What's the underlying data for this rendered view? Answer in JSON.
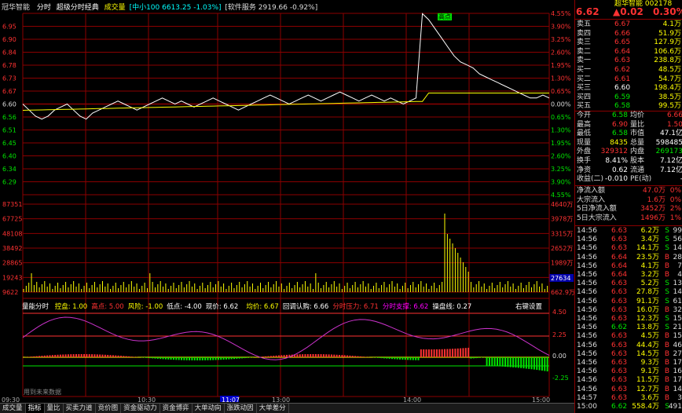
{
  "header": {
    "title": "冠华智能",
    "mode1": "分时",
    "mode2": "超级分时经典",
    "indicator": "成交量",
    "index_info": "[中小100 6613.25 -1.03%]",
    "sector_info": "[软件服务 2919.66 -0.92%]"
  },
  "price_axis_left": [
    "6.95",
    "6.90",
    "6.84",
    "6.78",
    "6.73",
    "6.67",
    "6.60",
    "6.56",
    "6.51",
    "6.45",
    "6.40",
    "6.34",
    "6.29"
  ],
  "pct_axis_right": [
    "4.55%",
    "3.90%",
    "3.25%",
    "2.60%",
    "1.95%",
    "1.30%",
    "0.65%",
    "0.00%",
    "0.65%",
    "1.30%",
    "1.95%",
    "2.60%",
    "3.25%",
    "3.90%",
    "4.55%"
  ],
  "vol_axis_left": [
    "87351",
    "67725",
    "48108",
    "38492",
    "28865",
    "19243",
    "9622"
  ],
  "vol_axis_right": [
    "4640万",
    "3978万",
    "3315万",
    "2652万",
    "1989万",
    "1326万",
    "662.9万"
  ],
  "vol_marker": "27634",
  "high_flag": "高点",
  "lower_panel": {
    "name": "量能分时",
    "items": [
      {
        "label": "控盘",
        "value": "1.00",
        "color": "#ffff00"
      },
      {
        "label": "高点",
        "value": "5.00",
        "color": "#ff3232"
      },
      {
        "label": "风险",
        "value": "-1.00",
        "color": "#ffff00"
      },
      {
        "label": "低点",
        "value": "-4.00",
        "color": "#ffffff"
      },
      {
        "label": "现价",
        "value": "6.62",
        "color": "#ffffff"
      },
      {
        "label": "",
        "value": "",
        "color": "#0000ff"
      },
      {
        "label": "均价",
        "value": "6.67",
        "color": "#ffff00"
      },
      {
        "label": "回调认购",
        "value": "6.66",
        "color": "#ffffff"
      },
      {
        "label": "分时压力",
        "value": "6.71",
        "color": "#ff3232"
      },
      {
        "label": "分时支撑",
        "value": "6.62",
        "color": "#ff00ff"
      },
      {
        "label": "操盘线",
        "value": "0.27",
        "color": "#ffffff"
      }
    ],
    "settings": "右键设置",
    "axis": [
      "4.50",
      "2.25",
      "0.00",
      "-2.25"
    ],
    "footnote": "用到未来数据"
  },
  "time_axis": [
    "09:30",
    "10:30",
    "11:07",
    "13:00",
    "14:00",
    "15:00"
  ],
  "tabs": [
    "成交量",
    "指标",
    "量比",
    "买卖力道",
    "竞价图",
    "资金驱动力",
    "资金博弈",
    "大单动向",
    "涨跌动因",
    "大单差分"
  ],
  "quote": {
    "price": "6.62",
    "change": "▲0.02",
    "pct": "0.30%",
    "code_hint": "超华智能 002178",
    "asks": [
      {
        "label": "卖五",
        "price": "6.67",
        "vol": "4.1万"
      },
      {
        "label": "卖四",
        "price": "6.66",
        "vol": "51.9万"
      },
      {
        "label": "卖三",
        "price": "6.65",
        "vol": "127.9万"
      },
      {
        "label": "卖二",
        "price": "6.64",
        "vol": "106.6万"
      },
      {
        "label": "卖一",
        "price": "6.63",
        "vol": "238.8万"
      }
    ],
    "bids": [
      {
        "label": "买一",
        "price": "6.62",
        "vol": "48.5万"
      },
      {
        "label": "买二",
        "price": "6.61",
        "vol": "54.7万"
      },
      {
        "label": "买三",
        "price": "6.60",
        "vol": "198.4万"
      },
      {
        "label": "买四",
        "price": "6.59",
        "vol": "38.5万"
      },
      {
        "label": "买五",
        "price": "6.58",
        "vol": "99.5万"
      }
    ],
    "stats": [
      {
        "l1": "今开",
        "v1": "6.58",
        "c1": "green",
        "l2": "均价",
        "v2": "6.66",
        "c2": "red"
      },
      {
        "l1": "最高",
        "v1": "6.90",
        "c1": "red",
        "l2": "量比",
        "v2": "1.50",
        "c2": "red"
      },
      {
        "l1": "最低",
        "v1": "6.58",
        "c1": "green",
        "l2": "市值",
        "v2": "47.1亿",
        "c2": "white"
      },
      {
        "l1": "现量",
        "v1": "8435",
        "c1": "yellow",
        "l2": "总量",
        "v2": "598485",
        "c2": "white"
      },
      {
        "l1": "外盘",
        "v1": "329312",
        "c1": "red",
        "l2": "内盘",
        "v2": "269173",
        "c2": "green"
      },
      {
        "l1": "换手",
        "v1": "8.41%",
        "c1": "white",
        "l2": "股本",
        "v2": "7.12亿",
        "c2": "white"
      },
      {
        "l1": "净资",
        "v1": "0.62",
        "c1": "white",
        "l2": "流通",
        "v2": "7.12亿",
        "c2": "white"
      },
      {
        "l1": "收益(二)",
        "v1": "-0.010",
        "c1": "white",
        "l2": "PE(动)",
        "v2": "-",
        "c2": "white"
      }
    ],
    "flows": [
      {
        "label": "净流入额",
        "value": "47.0万",
        "pct": "0%"
      },
      {
        "label": "大宗流入",
        "value": "1.6万",
        "pct": "0%"
      },
      {
        "label": "5日净流入额",
        "value": "3452万",
        "pct": "2%"
      },
      {
        "label": "5日大宗流入",
        "value": "1496万",
        "pct": "1%"
      }
    ],
    "trades": [
      {
        "t": "14:56",
        "p": "6.63",
        "v": "6.2万",
        "d": "S",
        "n": "99"
      },
      {
        "t": "14:56",
        "p": "6.63",
        "v": "3.4万",
        "d": "S",
        "n": "56"
      },
      {
        "t": "14:56",
        "p": "6.63",
        "v": "14.1万",
        "d": "S",
        "n": "14"
      },
      {
        "t": "14:56",
        "p": "6.64",
        "v": "23.5万",
        "d": "B",
        "n": "28"
      },
      {
        "t": "14:56",
        "p": "6.64",
        "v": "4.1万",
        "d": "B",
        "n": "7"
      },
      {
        "t": "14:56",
        "p": "6.64",
        "v": "3.2万",
        "d": "B",
        "n": "4"
      },
      {
        "t": "14:56",
        "p": "6.63",
        "v": "5.2万",
        "d": "S",
        "n": "13"
      },
      {
        "t": "14:56",
        "p": "6.63",
        "v": "27.8万",
        "d": "S",
        "n": "14"
      },
      {
        "t": "14:56",
        "p": "6.63",
        "v": "91.1万",
        "d": "S",
        "n": "61"
      },
      {
        "t": "14:56",
        "p": "6.63",
        "v": "16.0万",
        "d": "B",
        "n": "32"
      },
      {
        "t": "14:56",
        "p": "6.63",
        "v": "12.3万",
        "d": "S",
        "n": "15"
      },
      {
        "t": "14:56",
        "p": "6.62",
        "v": "13.8万",
        "d": "S",
        "n": "21"
      },
      {
        "t": "14:56",
        "p": "6.63",
        "v": "4.5万",
        "d": "B",
        "n": "15"
      },
      {
        "t": "14:56",
        "p": "6.63",
        "v": "44.4万",
        "d": "B",
        "n": "46"
      },
      {
        "t": "14:56",
        "p": "6.63",
        "v": "14.5万",
        "d": "B",
        "n": "27"
      },
      {
        "t": "14:56",
        "p": "6.63",
        "v": "9.3万",
        "d": "B",
        "n": "17"
      },
      {
        "t": "14:56",
        "p": "6.63",
        "v": "9.1万",
        "d": "B",
        "n": "16"
      },
      {
        "t": "14:56",
        "p": "6.63",
        "v": "11.5万",
        "d": "B",
        "n": "17"
      },
      {
        "t": "14:56",
        "p": "6.63",
        "v": "12.7万",
        "d": "B",
        "n": "14"
      },
      {
        "t": "14:57",
        "p": "6.63",
        "v": "3.6万",
        "d": "B",
        "n": "3"
      },
      {
        "t": "15:00",
        "p": "6.62",
        "v": "558.4万",
        "d": "S",
        "n": "491"
      }
    ]
  },
  "colors": {
    "bg": "#000000",
    "grid": "#8b0000",
    "up": "#ff3232",
    "down": "#00e600",
    "avg": "#ffff00"
  }
}
